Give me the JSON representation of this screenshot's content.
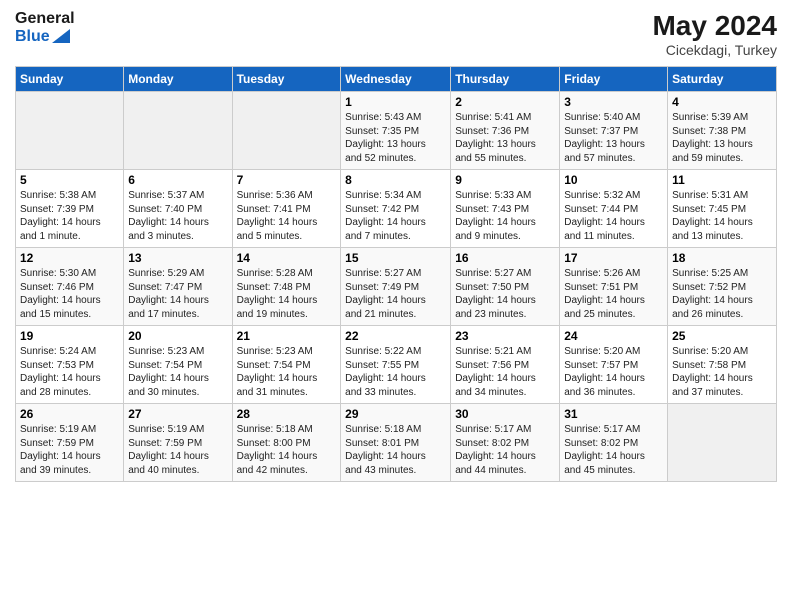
{
  "header": {
    "logo_general": "General",
    "logo_blue": "Blue",
    "month": "May 2024",
    "location": "Cicekdagi, Turkey"
  },
  "days_of_week": [
    "Sunday",
    "Monday",
    "Tuesday",
    "Wednesday",
    "Thursday",
    "Friday",
    "Saturday"
  ],
  "weeks": [
    [
      {
        "day": "",
        "info": ""
      },
      {
        "day": "",
        "info": ""
      },
      {
        "day": "",
        "info": ""
      },
      {
        "day": "1",
        "info": "Sunrise: 5:43 AM\nSunset: 7:35 PM\nDaylight: 13 hours\nand 52 minutes."
      },
      {
        "day": "2",
        "info": "Sunrise: 5:41 AM\nSunset: 7:36 PM\nDaylight: 13 hours\nand 55 minutes."
      },
      {
        "day": "3",
        "info": "Sunrise: 5:40 AM\nSunset: 7:37 PM\nDaylight: 13 hours\nand 57 minutes."
      },
      {
        "day": "4",
        "info": "Sunrise: 5:39 AM\nSunset: 7:38 PM\nDaylight: 13 hours\nand 59 minutes."
      }
    ],
    [
      {
        "day": "5",
        "info": "Sunrise: 5:38 AM\nSunset: 7:39 PM\nDaylight: 14 hours\nand 1 minute."
      },
      {
        "day": "6",
        "info": "Sunrise: 5:37 AM\nSunset: 7:40 PM\nDaylight: 14 hours\nand 3 minutes."
      },
      {
        "day": "7",
        "info": "Sunrise: 5:36 AM\nSunset: 7:41 PM\nDaylight: 14 hours\nand 5 minutes."
      },
      {
        "day": "8",
        "info": "Sunrise: 5:34 AM\nSunset: 7:42 PM\nDaylight: 14 hours\nand 7 minutes."
      },
      {
        "day": "9",
        "info": "Sunrise: 5:33 AM\nSunset: 7:43 PM\nDaylight: 14 hours\nand 9 minutes."
      },
      {
        "day": "10",
        "info": "Sunrise: 5:32 AM\nSunset: 7:44 PM\nDaylight: 14 hours\nand 11 minutes."
      },
      {
        "day": "11",
        "info": "Sunrise: 5:31 AM\nSunset: 7:45 PM\nDaylight: 14 hours\nand 13 minutes."
      }
    ],
    [
      {
        "day": "12",
        "info": "Sunrise: 5:30 AM\nSunset: 7:46 PM\nDaylight: 14 hours\nand 15 minutes."
      },
      {
        "day": "13",
        "info": "Sunrise: 5:29 AM\nSunset: 7:47 PM\nDaylight: 14 hours\nand 17 minutes."
      },
      {
        "day": "14",
        "info": "Sunrise: 5:28 AM\nSunset: 7:48 PM\nDaylight: 14 hours\nand 19 minutes."
      },
      {
        "day": "15",
        "info": "Sunrise: 5:27 AM\nSunset: 7:49 PM\nDaylight: 14 hours\nand 21 minutes."
      },
      {
        "day": "16",
        "info": "Sunrise: 5:27 AM\nSunset: 7:50 PM\nDaylight: 14 hours\nand 23 minutes."
      },
      {
        "day": "17",
        "info": "Sunrise: 5:26 AM\nSunset: 7:51 PM\nDaylight: 14 hours\nand 25 minutes."
      },
      {
        "day": "18",
        "info": "Sunrise: 5:25 AM\nSunset: 7:52 PM\nDaylight: 14 hours\nand 26 minutes."
      }
    ],
    [
      {
        "day": "19",
        "info": "Sunrise: 5:24 AM\nSunset: 7:53 PM\nDaylight: 14 hours\nand 28 minutes."
      },
      {
        "day": "20",
        "info": "Sunrise: 5:23 AM\nSunset: 7:54 PM\nDaylight: 14 hours\nand 30 minutes."
      },
      {
        "day": "21",
        "info": "Sunrise: 5:23 AM\nSunset: 7:54 PM\nDaylight: 14 hours\nand 31 minutes."
      },
      {
        "day": "22",
        "info": "Sunrise: 5:22 AM\nSunset: 7:55 PM\nDaylight: 14 hours\nand 33 minutes."
      },
      {
        "day": "23",
        "info": "Sunrise: 5:21 AM\nSunset: 7:56 PM\nDaylight: 14 hours\nand 34 minutes."
      },
      {
        "day": "24",
        "info": "Sunrise: 5:20 AM\nSunset: 7:57 PM\nDaylight: 14 hours\nand 36 minutes."
      },
      {
        "day": "25",
        "info": "Sunrise: 5:20 AM\nSunset: 7:58 PM\nDaylight: 14 hours\nand 37 minutes."
      }
    ],
    [
      {
        "day": "26",
        "info": "Sunrise: 5:19 AM\nSunset: 7:59 PM\nDaylight: 14 hours\nand 39 minutes."
      },
      {
        "day": "27",
        "info": "Sunrise: 5:19 AM\nSunset: 7:59 PM\nDaylight: 14 hours\nand 40 minutes."
      },
      {
        "day": "28",
        "info": "Sunrise: 5:18 AM\nSunset: 8:00 PM\nDaylight: 14 hours\nand 42 minutes."
      },
      {
        "day": "29",
        "info": "Sunrise: 5:18 AM\nSunset: 8:01 PM\nDaylight: 14 hours\nand 43 minutes."
      },
      {
        "day": "30",
        "info": "Sunrise: 5:17 AM\nSunset: 8:02 PM\nDaylight: 14 hours\nand 44 minutes."
      },
      {
        "day": "31",
        "info": "Sunrise: 5:17 AM\nSunset: 8:02 PM\nDaylight: 14 hours\nand 45 minutes."
      },
      {
        "day": "",
        "info": ""
      }
    ]
  ]
}
